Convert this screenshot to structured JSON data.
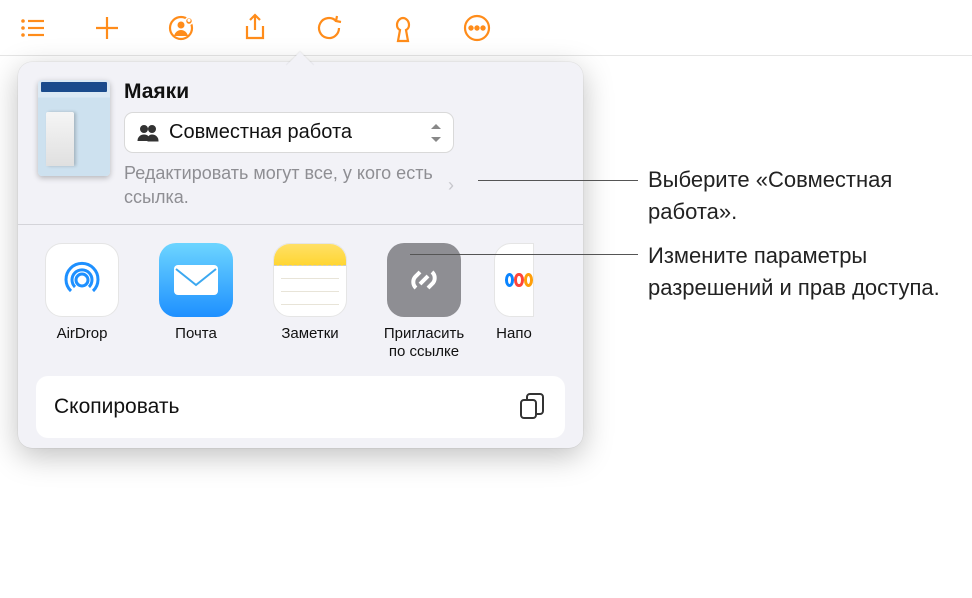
{
  "toolbar": {
    "icons": [
      "list-icon",
      "add-icon",
      "collaborate-icon",
      "share-icon",
      "undo-icon",
      "format-icon",
      "more-icon"
    ]
  },
  "doc": {
    "title": "Маяки"
  },
  "modeSelect": {
    "label": "Совместная работа"
  },
  "permissions": {
    "text": "Редактировать могут все, у кого есть ссылка."
  },
  "apps": [
    {
      "name": "airdrop",
      "label": "AirDrop"
    },
    {
      "name": "mail",
      "label": "Почта"
    },
    {
      "name": "notes",
      "label": "Заметки"
    },
    {
      "name": "invite-link",
      "label": "Пригласить\nпо ссылке"
    },
    {
      "name": "reminders",
      "label": "Напо"
    }
  ],
  "copy": {
    "label": "Скопировать"
  },
  "callouts": {
    "c1": "Выберите «Совместная работа».",
    "c2": "Измените параметры разрешений и прав доступа."
  }
}
